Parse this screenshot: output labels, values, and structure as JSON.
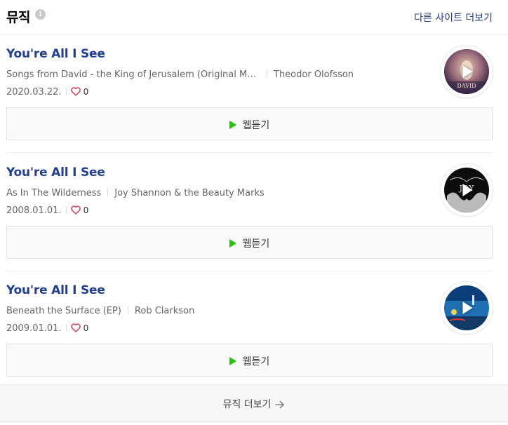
{
  "header": {
    "title": "뮤직",
    "info_icon_glyph": "i",
    "more_sites_label": "다른 사이트 더보기"
  },
  "songs": [
    {
      "title": "You're All I See",
      "album": "Songs from David - the King of Jerusalem (Original Mu...",
      "artist": "Theodor Olofsson",
      "date": "2020.03.22.",
      "likes": "0",
      "listen_label": "웹듣기",
      "cover_icon": "album-cover-david"
    },
    {
      "title": "You're All I See",
      "album": "As In The Wilderness",
      "artist": "Joy Shannon & the Beauty Marks",
      "date": "2008.01.01.",
      "likes": "0",
      "listen_label": "웹듣기",
      "cover_icon": "album-cover-joy"
    },
    {
      "title": "You're All I See",
      "album": "Beneath the Surface (EP)",
      "artist": "Rob Clarkson",
      "date": "2009.01.01.",
      "likes": "0",
      "listen_label": "웹듣기",
      "cover_icon": "album-cover-beneath"
    }
  ],
  "footer": {
    "more_music_label": "뮤직 더보기"
  },
  "colors": {
    "title_blue": "#1f3d99",
    "link_blue": "#1d3c8f",
    "play_green": "#1ec800",
    "heart_red": "#e0304e"
  }
}
